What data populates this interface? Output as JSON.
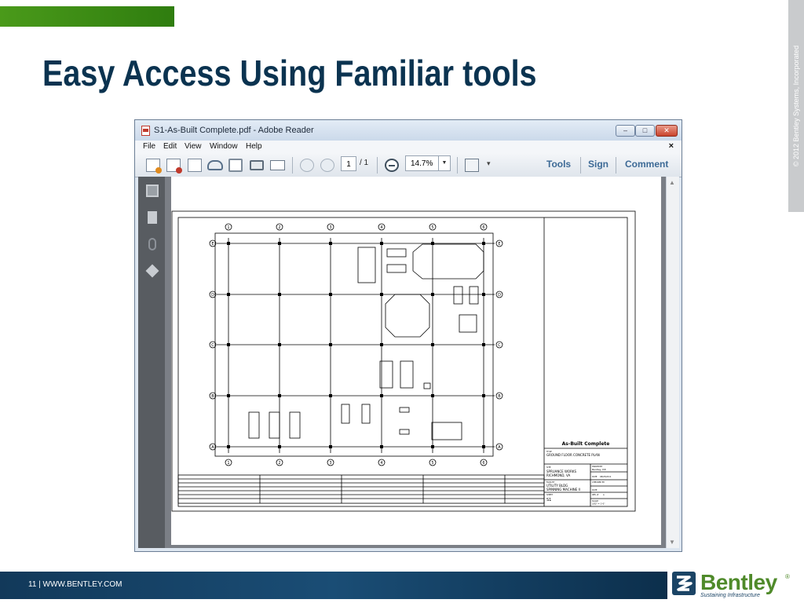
{
  "slide": {
    "title": "Easy Access Using Familiar tools",
    "copyright": "© 2012 Bentley Systems, Incorporated",
    "footer": "11 | WWW.BENTLEY.COM",
    "logo_text": "Bentley",
    "logo_reg": "®",
    "logo_tagline": "Sustaining Infrastructure"
  },
  "window": {
    "title": "S1-As-Built Complete.pdf - Adobe Reader",
    "controls": {
      "minimize": "–",
      "maximize": "□",
      "close": "✕"
    },
    "menu": [
      "File",
      "Edit",
      "View",
      "Window",
      "Help"
    ],
    "menu_close": "×"
  },
  "toolbar": {
    "page_current": "1",
    "page_total": "/ 1",
    "zoom": "14.7%",
    "zoom_arrow": "▼",
    "more": "▾",
    "tools": "Tools",
    "sign": "Sign",
    "comment": "Comment"
  },
  "icons": [
    "open-file-icon",
    "create-pdf-icon",
    "edit-icon",
    "cloud-upload-icon",
    "save-icon",
    "print-icon",
    "email-icon",
    "prev-page-icon",
    "next-page-icon",
    "zoom-out-icon",
    "fit-page-icon",
    "pages-icon",
    "bookmark-icon",
    "attachment-icon",
    "layers-icon"
  ],
  "drawing": {
    "col_labels": [
      "1",
      "2",
      "3",
      "4",
      "5",
      "6"
    ],
    "row_labels": [
      "E",
      "D",
      "C",
      "B",
      "A"
    ],
    "title_block": {
      "header": "As-Built Complete",
      "title_label": "TITLE",
      "title_value": "GROUND FLOOR CONCRETE PLAN",
      "site_label": "SITE",
      "site_value1": "SPRUANCE WORKS",
      "site_value2": "RICHMOND, VA",
      "drawn_by_label": "DRAWN BY",
      "drawn_by_value": "Bentley, P.E.",
      "date_label": "DATE",
      "date_value": "08/25/2011",
      "facility_label": "FACILITY",
      "facility_value1": "UTILITY BLDG",
      "facility_value2": "SPINNING MACHINE II",
      "checked_by_label": "CHECKED BY",
      "date2_label": "DATE",
      "sheet_label": "SHEET",
      "sheet_value": "S1",
      "rev_label": "REV. #",
      "rev_value": "A",
      "scale_label": "SCALE",
      "scale_value": "3/32\" = 1'-0\""
    }
  }
}
